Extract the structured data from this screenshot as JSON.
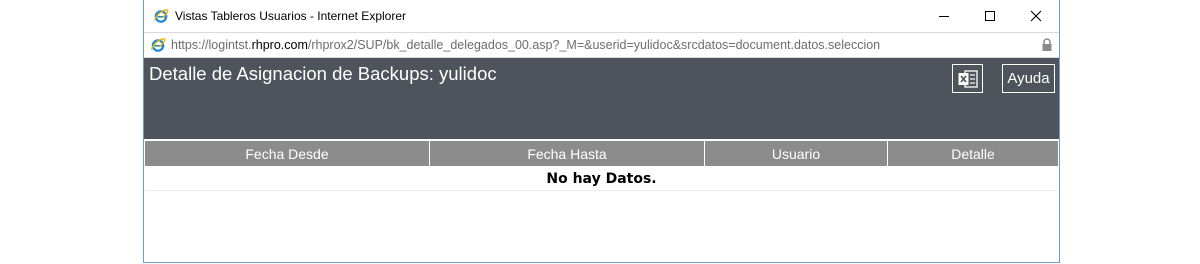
{
  "window": {
    "title": "Vistas Tableros Usuarios - Internet Explorer",
    "controls": [
      "minimize",
      "maximize",
      "close"
    ]
  },
  "address": {
    "prefix": "https://logintst.",
    "domain": "rhpro.com",
    "path": "/rhprox2/SUP/bk_detalle_delegados_00.asp?_M=&userid=yulidoc&srcdatos=document.datos.seleccion"
  },
  "header": {
    "title": "Detalle de Asignacion de Backups: yulidoc",
    "help_label": "Ayuda",
    "excel_icon": "excel-icon",
    "background": "#4f535b"
  },
  "table": {
    "columns": [
      "Fecha Desde",
      "Fecha Hasta",
      "Usuario",
      "Detalle"
    ],
    "empty_message": "No hay Datos.",
    "header_color": "#8c8c8c"
  }
}
